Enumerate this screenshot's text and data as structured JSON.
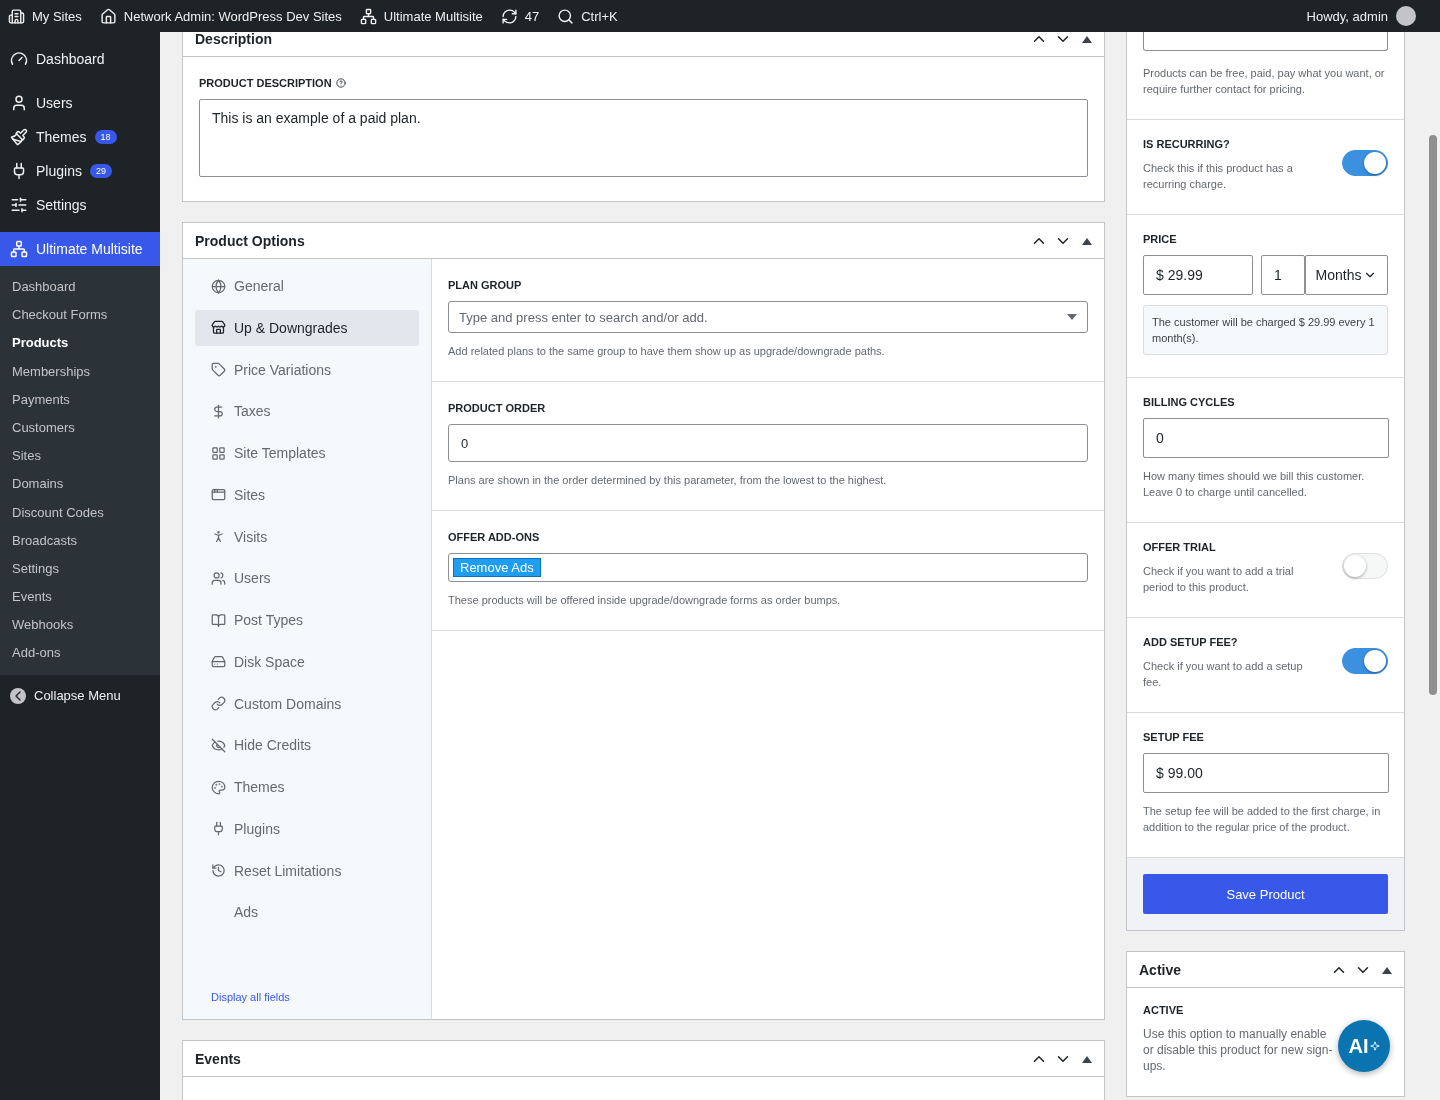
{
  "admin_bar": {
    "items": [
      {
        "kind": "sites",
        "label": "My Sites"
      },
      {
        "kind": "home",
        "label": "Network Admin: WordPress Dev Sites"
      },
      {
        "kind": "network",
        "label": "Ultimate Multisite"
      },
      {
        "kind": "updates",
        "label": "47"
      },
      {
        "kind": "search",
        "label": "Ctrl+K"
      }
    ],
    "greeting": "Howdy, admin"
  },
  "admin_menu": {
    "items": [
      {
        "kind": "dashboard",
        "label": "Dashboard"
      },
      {
        "kind": "users",
        "label": "Users"
      },
      {
        "kind": "themes",
        "label": "Themes",
        "badge": "18"
      },
      {
        "kind": "plugins",
        "label": "Plugins",
        "badge": "29"
      },
      {
        "kind": "settings",
        "label": "Settings"
      }
    ],
    "current": {
      "label": "Ultimate Multisite"
    },
    "submenu": [
      {
        "label": "Dashboard",
        "selected": false
      },
      {
        "label": "Checkout Forms",
        "selected": false
      },
      {
        "label": "Products",
        "selected": true
      },
      {
        "label": "Memberships",
        "selected": false
      },
      {
        "label": "Payments",
        "selected": false
      },
      {
        "label": "Customers",
        "selected": false
      },
      {
        "label": "Sites",
        "selected": false
      },
      {
        "label": "Domains",
        "selected": false
      },
      {
        "label": "Discount Codes",
        "selected": false
      },
      {
        "label": "Broadcasts",
        "selected": false
      },
      {
        "label": "Settings",
        "selected": false
      },
      {
        "label": "Events",
        "selected": false
      },
      {
        "label": "Webhooks",
        "selected": false
      },
      {
        "label": "Add-ons",
        "selected": false
      }
    ],
    "collapse": "Collapse Menu"
  },
  "description_box": {
    "title": "Description",
    "field_label": "PRODUCT DESCRIPTION",
    "value": "This is an example of a paid plan."
  },
  "product_options": {
    "title": "Product Options",
    "tabs": [
      {
        "label": "General",
        "selected": false
      },
      {
        "label": "Up & Downgrades",
        "selected": true
      },
      {
        "label": "Price Variations",
        "selected": false
      },
      {
        "label": "Taxes",
        "selected": false
      },
      {
        "label": "Site Templates",
        "selected": false
      },
      {
        "label": "Sites",
        "selected": false
      },
      {
        "label": "Visits",
        "selected": false
      },
      {
        "label": "Users",
        "selected": false
      },
      {
        "label": "Post Types",
        "selected": false
      },
      {
        "label": "Disk Space",
        "selected": false
      },
      {
        "label": "Custom Domains",
        "selected": false
      },
      {
        "label": "Hide Credits",
        "selected": false
      },
      {
        "label": "Themes",
        "selected": false
      },
      {
        "label": "Plugins",
        "selected": false
      },
      {
        "label": "Reset Limitations",
        "selected": false
      },
      {
        "label": "Ads",
        "selected": false
      }
    ],
    "footer_link": "Display all fields",
    "fields": [
      {
        "kind": "select",
        "label": "PLAN GROUP",
        "placeholder": "Type and press enter to search and/or add.",
        "help": "Add related plans to the same group to have them show up as upgrade/downgrade paths."
      },
      {
        "kind": "text",
        "label": "PRODUCT ORDER",
        "value": "0",
        "help": "Plans are shown in the order determined by this parameter, from the lowest to the highest."
      },
      {
        "kind": "tags",
        "label": "OFFER ADD-ONS",
        "tags": [
          "Remove Ads"
        ],
        "help": "These products will be offered inside upgrade/downgrade forms as order bumps."
      }
    ]
  },
  "side_panel": {
    "sections": [
      {
        "kind": "help",
        "help": "Products can be free, paid, pay what you want, or require further contact for pricing."
      },
      {
        "kind": "toggle",
        "label": "IS RECURRING?",
        "help": "Check this if this product has a recurring charge.",
        "on": true
      },
      {
        "kind": "price",
        "label": "PRICE",
        "amount": "$ 29.99",
        "interval": "1",
        "unit": "Months",
        "notice": "The customer will be charged $ 29.99 every 1 month(s)."
      },
      {
        "kind": "text",
        "label": "BILLING CYCLES",
        "value": "0",
        "help": "How many times should we bill this customer. Leave 0 to charge until cancelled."
      },
      {
        "kind": "toggle",
        "label": "OFFER TRIAL",
        "help": "Check if you want to add a trial period to this product.",
        "on": false
      },
      {
        "kind": "toggle",
        "label": "ADD SETUP FEE?",
        "help": "Check if you want to add a setup fee.",
        "on": true
      },
      {
        "kind": "text",
        "label": "SETUP FEE",
        "value": "$ 99.00",
        "help": "The setup fee will be added to the first charge, in addition to the regular price of the product."
      }
    ],
    "save_button": "Save Product"
  },
  "active_box": {
    "title": "Active",
    "field_label": "ACTIVE",
    "help": "Use this option to manually enable or disable this product for new sign-ups."
  },
  "events_box": {
    "title": "Events"
  },
  "assistant_button": {
    "label": "AI"
  }
}
